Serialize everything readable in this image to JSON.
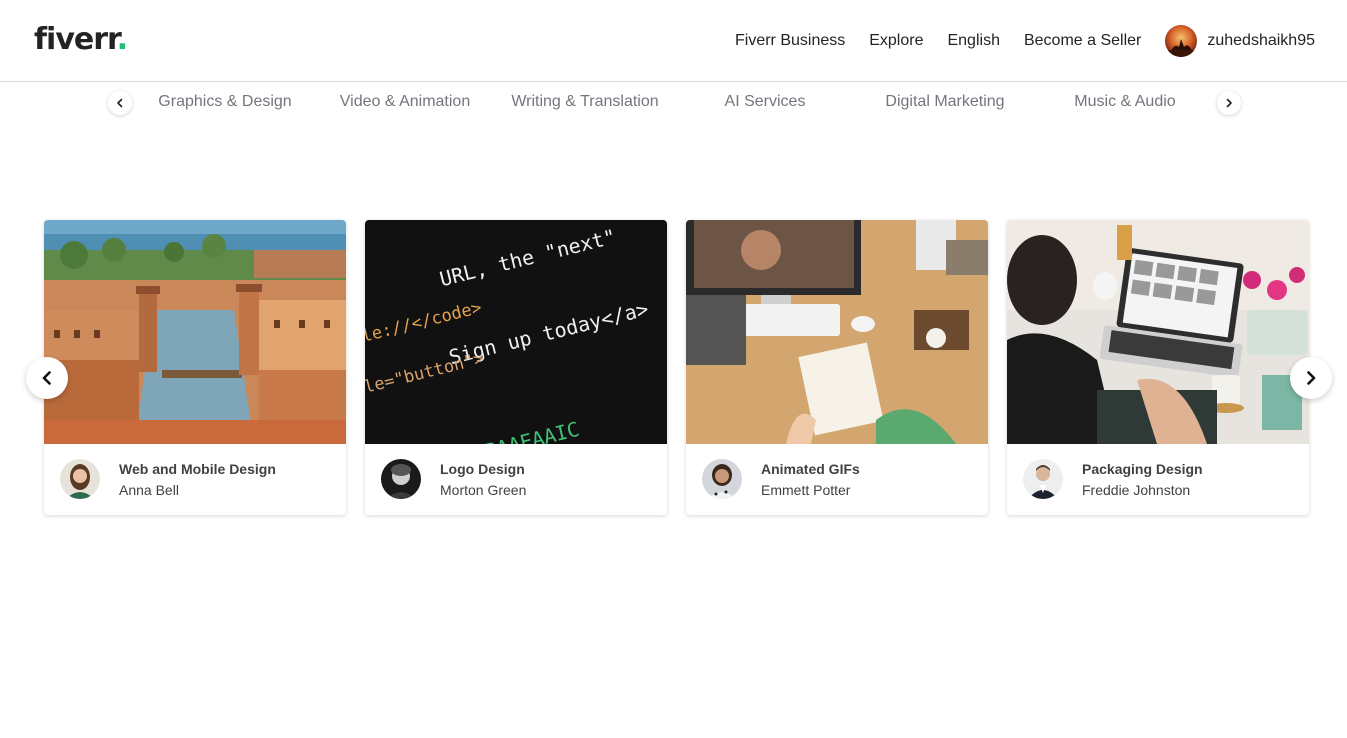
{
  "header": {
    "logo_text": "fiverr",
    "logo_dot": ".",
    "nav": [
      {
        "label": "Fiverr Business"
      },
      {
        "label": "Explore"
      },
      {
        "label": "English"
      },
      {
        "label": "Become a Seller"
      }
    ],
    "username": "zuhedshaikh95"
  },
  "categories": {
    "items": [
      {
        "label": "Graphics & Design"
      },
      {
        "label": "Video & Animation"
      },
      {
        "label": "Writing & Translation"
      },
      {
        "label": "AI Services"
      },
      {
        "label": "Digital Marketing"
      },
      {
        "label": "Music & Audio"
      }
    ],
    "prev_icon": "chevron-left-icon",
    "next_icon": "chevron-right-icon"
  },
  "carousel": {
    "cards": [
      {
        "title": "Web and Mobile Design",
        "seller": "Anna Bell",
        "image": "venice-cityscape"
      },
      {
        "title": "Logo Design",
        "seller": "Morton Green",
        "image": "code-screen"
      },
      {
        "title": "Animated GIFs",
        "seller": "Emmett Potter",
        "image": "desk-video-call"
      },
      {
        "title": "Packaging Design",
        "seller": "Freddie Johnston",
        "image": "woman-laptop"
      }
    ],
    "code_lines": [
      "URL, the \"next\"",
      "file://</code>",
      "Sign up today</a>",
      "role=\"button\">",
      "AAAAAABAAEAAIC"
    ]
  },
  "colors": {
    "brand_green": "#1dbf73",
    "text_dark": "#222325",
    "text_muted": "#74767e"
  }
}
